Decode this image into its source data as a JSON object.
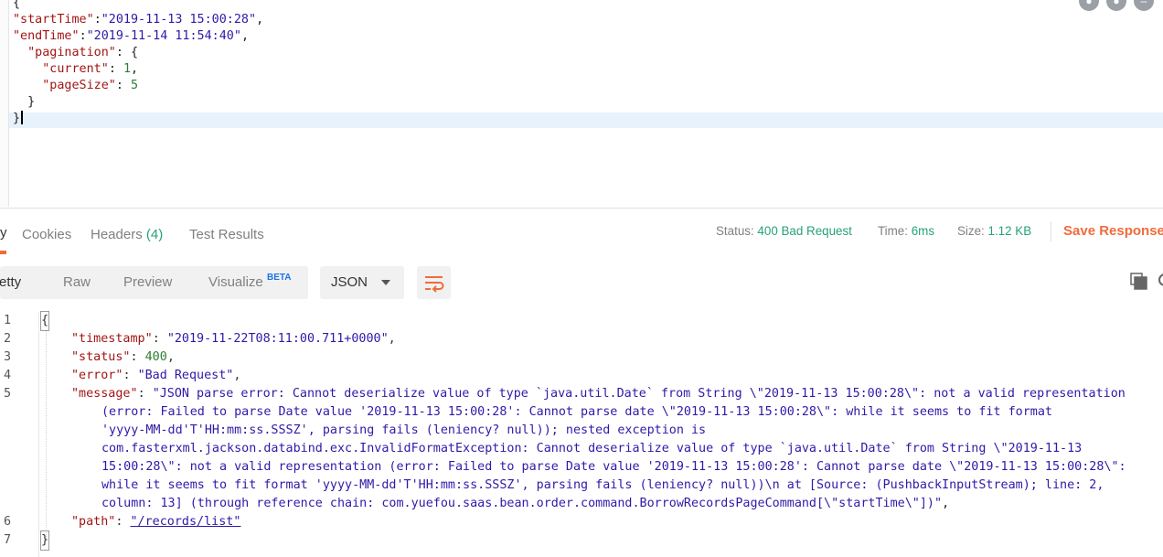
{
  "request_body": {
    "open": "{",
    "startTime_key": "\"startTime\"",
    "startTime_val": "\"2019-11-13 15:00:28\"",
    "endTime_key": "\"endTime\"",
    "endTime_val": "\"2019-11-14 11:54:40\"",
    "pagination_key": "\"pagination\"",
    "current_key": "\"current\"",
    "current_val": "1",
    "pageSize_key": "\"pageSize\"",
    "pageSize_val": "5",
    "inner_close": "}",
    "close": "}"
  },
  "response_tabs": {
    "body_fragment": "y",
    "cookies": "Cookies",
    "headers": "Headers",
    "headers_count": "(4)",
    "test_results": "Test Results"
  },
  "status_bar": {
    "status_label": "Status:",
    "status_value": "400 Bad Request",
    "time_label": "Time:",
    "time_value": "6ms",
    "size_label": "Size:",
    "size_value": "1.12 KB",
    "save_response": "Save Response"
  },
  "toolbar": {
    "pretty": "retty",
    "raw": "Raw",
    "preview": "Preview",
    "visualize": "Visualize",
    "beta": "BETA",
    "format": "JSON"
  },
  "response_body": {
    "line_numbers": [
      "1",
      "2",
      "3",
      "4",
      "5",
      "6",
      "7"
    ],
    "open": "{",
    "timestamp_key": "\"timestamp\"",
    "timestamp_val": "\"2019-11-22T08:11:00.711+0000\"",
    "status_key": "\"status\"",
    "status_val": "400",
    "error_key": "\"error\"",
    "error_val": "\"Bad Request\"",
    "message_key": "\"message\"",
    "message_lines": [
      "\"JSON parse error: Cannot deserialize value of type `java.util.Date` from String \\\"2019-11-13 15:00:28\\\": not a valid representation",
      "(error: Failed to parse Date value '2019-11-13 15:00:28': Cannot parse date \\\"2019-11-13 15:00:28\\\": while it seems to fit format",
      "'yyyy-MM-dd'T'HH:mm:ss.SSSZ', parsing fails (leniency? null)); nested exception is",
      "com.fasterxml.jackson.databind.exc.InvalidFormatException: Cannot deserialize value of type `java.util.Date` from String \\\"2019-11-13",
      "15:00:28\\\": not a valid representation (error: Failed to parse Date value '2019-11-13 15:00:28': Cannot parse date \\\"2019-11-13 15:00:28\\\":",
      "while it seems to fit format 'yyyy-MM-dd'T'HH:mm:ss.SSSZ', parsing fails (leniency? null))\\n at [Source: (PushbackInputStream); line: 2,",
      "column: 13] (through reference chain: com.yuefou.saas.bean.order.command.BorrowRecordsPageCommand[\\\"startTime\\\"])\""
    ],
    "path_key": "\"path\"",
    "path_val": "\"/records/list\"",
    "close": "}"
  },
  "colors": {
    "accent_orange": "#f26b3a",
    "status_green": "#27a27a",
    "json_key": "#a31515",
    "json_string": "#2f1aa8"
  }
}
